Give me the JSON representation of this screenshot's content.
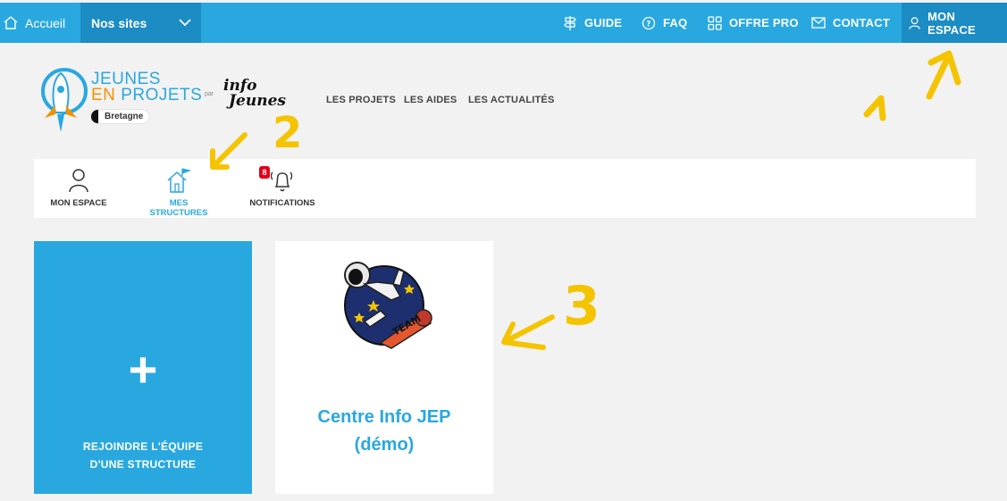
{
  "topbar": {
    "home_label": "Accueil",
    "sites_label": "Nos sites",
    "nav": [
      {
        "label": "GUIDE",
        "icon": "signpost-icon"
      },
      {
        "label": "FAQ",
        "icon": "question-icon"
      },
      {
        "label": "OFFRE PRO",
        "icon": "grid-icon"
      },
      {
        "label": "CONTACT",
        "icon": "mail-icon"
      },
      {
        "label": "MON ESPACE",
        "icon": "user-icon"
      }
    ]
  },
  "logo": {
    "line1": "JEUNES",
    "line2_a": "EN ",
    "line2_b": "PROJETS",
    "region": "Bretagne",
    "par": "par",
    "partner_line1": "info",
    "partner_line2": "Jeunes"
  },
  "mainnav": [
    "LES PROJETS",
    "LES AIDES",
    "LES ACTUALITÉS"
  ],
  "tabs": [
    {
      "label": "MON ESPACE",
      "icon": "user-icon"
    },
    {
      "label": "MES STRUCTURES",
      "icon": "house-flag-icon",
      "active": true
    },
    {
      "label": "NOTIFICATIONS",
      "icon": "bell-icon",
      "count": "8"
    }
  ],
  "cards": {
    "join_plus": "+",
    "join_label_1": "REJOINDRE L'ÉQUIPE",
    "join_label_2": "D'UNE STRUCTURE",
    "structure_name_1": "Centre Info JEP",
    "structure_name_2": "(démo)",
    "structure_logo_text": "TEAM"
  },
  "annotations": [
    "1",
    "2",
    "3"
  ],
  "colors": {
    "brand_blue": "#29a8e0",
    "dark_blue": "#1c8cc4",
    "orange": "#f39200",
    "annotation_yellow": "#f5c400",
    "badge_red": "#e3001b"
  }
}
